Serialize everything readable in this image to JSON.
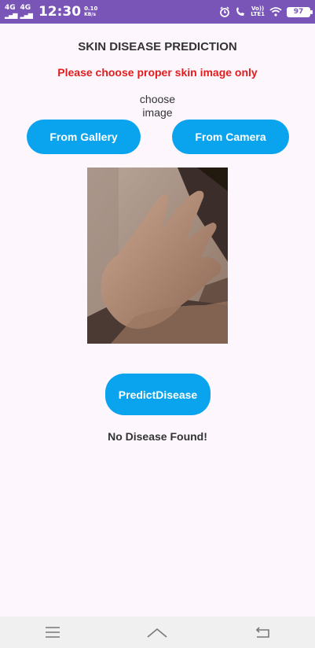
{
  "status_bar": {
    "sim1_type": "4G",
    "sim2_type": "4G",
    "time": "12:30",
    "net_speed_value": "0.10",
    "net_speed_unit": "KB/s",
    "volte_top": "Vo))",
    "volte_bottom": "LTE1",
    "battery": "97"
  },
  "header": {
    "title": "SKIN DISEASE PREDICTION",
    "warning": "Please choose proper skin image only"
  },
  "chooser": {
    "label_line1": "choose",
    "label_line2": "image",
    "gallery_label": "From Gallery",
    "camera_label": "From Camera"
  },
  "predict": {
    "label_line1": "Predict",
    "label_line2": "Disease"
  },
  "result": {
    "text": "No Disease Found!"
  },
  "colors": {
    "status_bar": "#7a55b8",
    "button": "#0aa3ee",
    "warning": "#e11d1d",
    "background": "#fdf7fd"
  },
  "icons": {
    "alarm": "alarm-icon",
    "wifi_call": "wifi-call-icon",
    "wifi": "wifi-icon",
    "menu": "menu-icon",
    "home": "home-icon",
    "back": "back-icon"
  }
}
